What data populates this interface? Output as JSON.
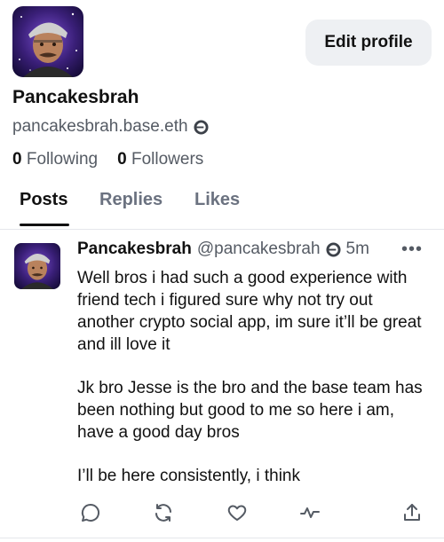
{
  "profile": {
    "display_name": "Pancakesbrah",
    "handle": "pancakesbrah.base.eth",
    "following_count": "0",
    "following_label": "Following",
    "followers_count": "0",
    "followers_label": "Followers",
    "edit_label": "Edit profile",
    "avatar_icon": "profile-avatar-photo",
    "badge_icon": "base-badge-icon"
  },
  "tabs": [
    {
      "label": "Posts",
      "active": true
    },
    {
      "label": "Replies",
      "active": false
    },
    {
      "label": "Likes",
      "active": false
    }
  ],
  "post": {
    "author": "Pancakesbrah",
    "handle": "@pancakesbrah",
    "time": "5m",
    "more_label": "•••",
    "paragraphs": [
      "Well bros i had such a good experience with friend tech i figured sure why not try out another crypto social app, im sure it’ll be great and ill love it",
      "Jk bro Jesse is the bro and the base team has been nothing but good to me so here i am, have a good day bros",
      "I’ll be here consistently, i think"
    ],
    "actions": [
      "reply-icon",
      "repost-icon",
      "like-icon",
      "activity-icon",
      "share-icon"
    ]
  },
  "colors": {
    "text": "#111111",
    "secondary": "#555b64",
    "button_bg": "#eef0f3",
    "divider": "#e5e7eb"
  }
}
